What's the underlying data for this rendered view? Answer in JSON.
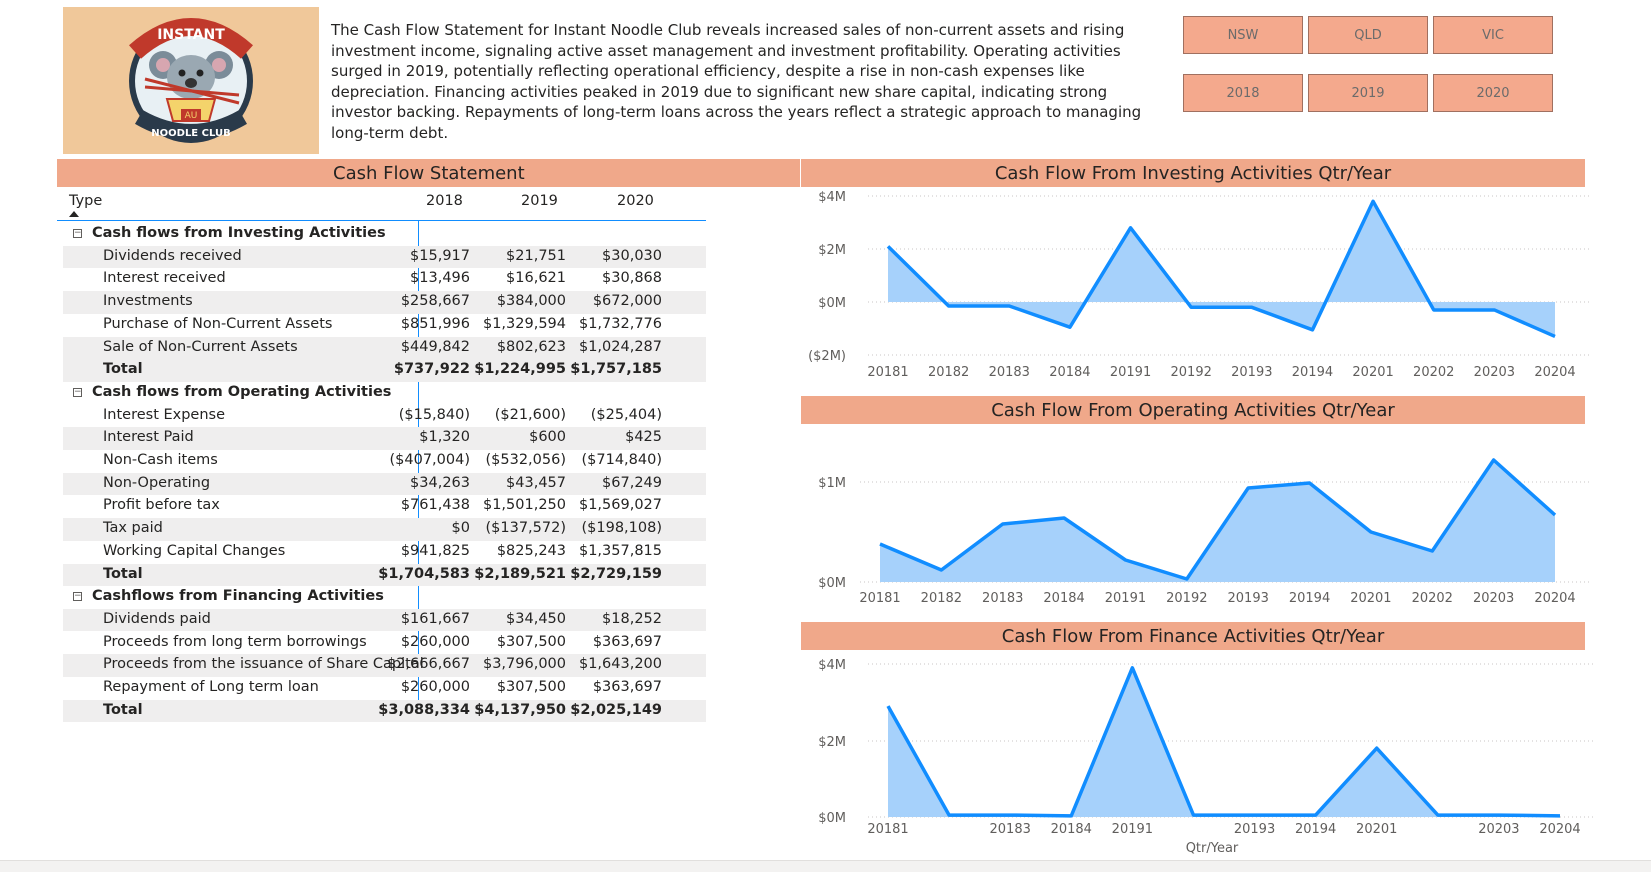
{
  "summary": "The Cash Flow Statement for Instant Noodle Club reveals increased sales of non-current assets and rising investment income, signaling active asset management and investment profitability. Operating activities surged in 2019, potentially reflecting operational efficiency, despite a rise in non-cash expenses like depreciation. Financing activities peaked in 2019 due to significant new share capital, indicating strong investor backing. Repayments of long-term loans across the years reflect a strategic approach to managing long-term debt.",
  "logo": {
    "top_text": "INSTANT",
    "badge": "AU",
    "bottom_text": "NOODLE CLUB",
    "bg_color": "#f0c89a"
  },
  "slicers": {
    "states": [
      "NSW",
      "QLD",
      "VIC"
    ],
    "years": [
      "2018",
      "2019",
      "2020"
    ]
  },
  "table": {
    "title": "Cash Flow Statement",
    "col_type": "Type",
    "years": [
      "2018",
      "2019",
      "2020"
    ],
    "groups": [
      {
        "label": "Cash flows from Investing Activities",
        "rows": [
          {
            "label": "Dividends received",
            "values": [
              "$15,917",
              "$21,751",
              "$30,030"
            ]
          },
          {
            "label": "Interest received",
            "values": [
              "$13,496",
              "$16,621",
              "$30,868"
            ]
          },
          {
            "label": "Investments",
            "values": [
              "$258,667",
              "$384,000",
              "$672,000"
            ]
          },
          {
            "label": "Purchase of Non-Current Assets",
            "values": [
              "$851,996",
              "$1,329,594",
              "$1,732,776"
            ]
          },
          {
            "label": "Sale of Non-Current Assets",
            "values": [
              "$449,842",
              "$802,623",
              "$1,024,287"
            ]
          }
        ],
        "total": {
          "label": "Total",
          "values": [
            "$737,922",
            "$1,224,995",
            "$1,757,185"
          ]
        }
      },
      {
        "label": "Cash flows from Operating Activities",
        "rows": [
          {
            "label": "Interest Expense",
            "values": [
              "($15,840)",
              "($21,600)",
              "($25,404)"
            ]
          },
          {
            "label": "Interest Paid",
            "values": [
              "$1,320",
              "$600",
              "$425"
            ]
          },
          {
            "label": "Non-Cash items",
            "values": [
              "($407,004)",
              "($532,056)",
              "($714,840)"
            ]
          },
          {
            "label": "Non-Operating",
            "values": [
              "$34,263",
              "$43,457",
              "$67,249"
            ]
          },
          {
            "label": "Profit before tax",
            "values": [
              "$761,438",
              "$1,501,250",
              "$1,569,027"
            ]
          },
          {
            "label": "Tax paid",
            "values": [
              "$0",
              "($137,572)",
              "($198,108)"
            ]
          },
          {
            "label": "Working Capital Changes",
            "values": [
              "$941,825",
              "$825,243",
              "$1,357,815"
            ]
          }
        ],
        "total": {
          "label": "Total",
          "values": [
            "$1,704,583",
            "$2,189,521",
            "$2,729,159"
          ]
        }
      },
      {
        "label": "Cashflows from Financing Activities",
        "rows": [
          {
            "label": "Dividends paid",
            "values": [
              "$161,667",
              "$34,450",
              "$18,252"
            ]
          },
          {
            "label": "Proceeds from long term borrowings",
            "values": [
              "$260,000",
              "$307,500",
              "$363,697"
            ]
          },
          {
            "label": "Proceeds from the issuance of Share Capital",
            "values": [
              "$2,666,667",
              "$3,796,000",
              "$1,643,200"
            ]
          },
          {
            "label": "Repayment of Long term loan",
            "values": [
              "$260,000",
              "$307,500",
              "$363,697"
            ]
          }
        ],
        "total": {
          "label": "Total",
          "values": [
            "$3,088,334",
            "$4,137,950",
            "$2,025,149"
          ]
        }
      }
    ]
  },
  "chart_data": [
    {
      "type": "area",
      "title": "Cash Flow From Investing Activities Qtr/Year",
      "x": [
        "20181",
        "20182",
        "20183",
        "20184",
        "20191",
        "20192",
        "20193",
        "20194",
        "20201",
        "20202",
        "20203",
        "20204"
      ],
      "values": [
        2.1,
        -0.15,
        -0.15,
        -0.95,
        2.8,
        -0.2,
        -0.2,
        -1.05,
        3.8,
        -0.3,
        -0.3,
        -1.3
      ],
      "yticks": [
        "$4M",
        "$2M",
        "$0M",
        "($2M)"
      ],
      "ylim": [
        -2,
        4
      ],
      "color": "#118dff",
      "fill": "#a6d1fb"
    },
    {
      "type": "area",
      "title": "Cash Flow From Operating Activities Qtr/Year",
      "x": [
        "20181",
        "20182",
        "20183",
        "20184",
        "20191",
        "20192",
        "20193",
        "20194",
        "20201",
        "20202",
        "20203",
        "20204"
      ],
      "values": [
        0.38,
        0.12,
        0.58,
        0.64,
        0.22,
        0.03,
        0.94,
        0.99,
        0.5,
        0.31,
        1.22,
        0.67
      ],
      "yticks": [
        "$1M",
        "$0M"
      ],
      "ylim": [
        0,
        1.4
      ],
      "color": "#118dff",
      "fill": "#a6d1fb"
    },
    {
      "type": "area",
      "title": "Cash Flow From Finance Activities Qtr/Year",
      "x": [
        "20181",
        "20182",
        "20183",
        "20184",
        "20191",
        "20192",
        "20193",
        "20194",
        "20201",
        "20202",
        "20203",
        "20204"
      ],
      "xticks": [
        "20181",
        "20183",
        "20184",
        "20191",
        "20193",
        "20194",
        "20201",
        "20203",
        "20204"
      ],
      "values": [
        2.9,
        0.05,
        0.05,
        0.03,
        3.9,
        0.05,
        0.05,
        0.05,
        1.8,
        0.05,
        0.05,
        0.03
      ],
      "yticks": [
        "$4M",
        "$2M",
        "$0M"
      ],
      "ylim": [
        0,
        4
      ],
      "xlabel": "Qtr/Year",
      "color": "#118dff",
      "fill": "#a6d1fb"
    }
  ]
}
